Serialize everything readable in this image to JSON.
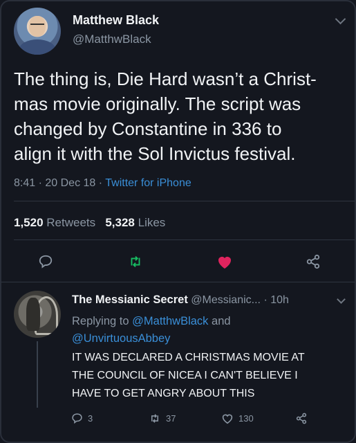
{
  "tweet": {
    "author_name": "Matthew Black",
    "author_handle": "@MatthwBlack",
    "text_lines": [
      "The thing is, Die Hard wasn’t a Christ-",
      "mas movie originally. The script was",
      "changed by Constantine in 336 to",
      "align it with the Sol Invictus festival."
    ],
    "time": "8:41",
    "date": "20 Dec 18",
    "source": "Twitter for iPhone",
    "retweets_count": "1,520",
    "retweets_label": "Retweets",
    "likes_count": "5,328",
    "likes_label": "Likes",
    "icons": [
      "reply-icon",
      "retweet-icon",
      "heart-icon",
      "share-icon"
    ],
    "like_color": "#e0245e",
    "retweet_color": "#17bf63"
  },
  "reply": {
    "author_name": "The Messianic Secret",
    "author_handle": "@Messianic...",
    "age": "10h",
    "replying_prefix": "Replying to",
    "replying_to_1": "@MatthwBlack",
    "replying_and": "and",
    "replying_to_2": "@UnvirtuousAbbey",
    "text_lines": [
      "IT WAS DECLARED A CHRISTMAS MOVIE AT",
      "THE COUNCIL OF NICEA I CAN'T BELIEVE I",
      "HAVE TO GET ANGRY ABOUT THIS"
    ],
    "reply_count": "3",
    "retweet_count": "37",
    "like_count": "130"
  },
  "colors": {
    "background": "#14171f",
    "link": "#3a8fd8",
    "secondary_text": "#8b96a3"
  }
}
